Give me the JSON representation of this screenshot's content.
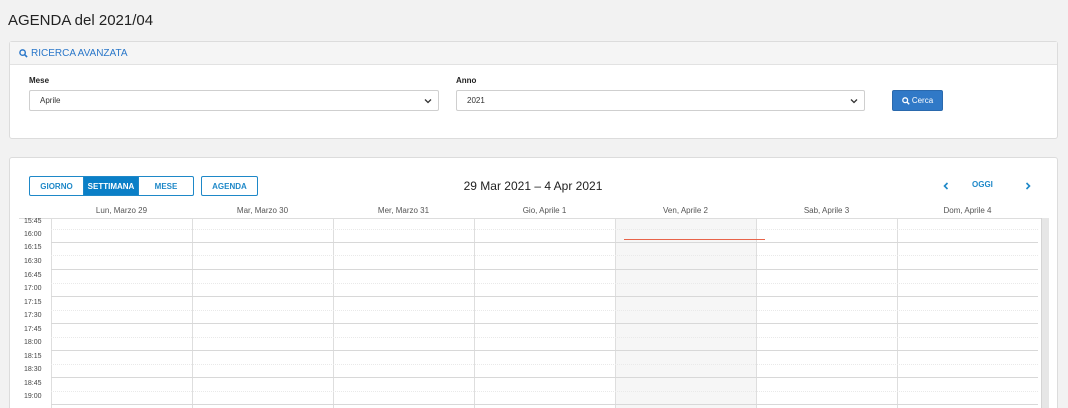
{
  "page": {
    "title": "AGENDA del 2021/04"
  },
  "search": {
    "header": "RICERCA AVANZATA",
    "month_label": "Mese",
    "month_value": "Aprile",
    "year_label": "Anno",
    "year_value": "2021",
    "search_button": "Cerca"
  },
  "calendar": {
    "views": [
      "GIORNO",
      "SETTIMANA",
      "MESE"
    ],
    "active_view": "SETTIMANA",
    "agenda_button": "AGENDA",
    "range_title": "29 Mar 2021 – 4 Apr 2021",
    "today_button": "OGGI",
    "days": [
      "Lun, Marzo 29",
      "Mar, Marzo 30",
      "Mer, Marzo 31",
      "Gio, Aprile 1",
      "Ven, Aprile 2",
      "Sab, Aprile 3",
      "Dom, Aprile 4"
    ],
    "today_index": 4,
    "times": [
      "15:45",
      "16:00",
      "16:15",
      "16:30",
      "16:45",
      "17:00",
      "17:15",
      "17:30",
      "17:45",
      "18:00",
      "18:15",
      "18:30",
      "18:45",
      "19:00"
    ]
  },
  "colors": {
    "accent": "#1e88c8",
    "search_button": "#3079c7",
    "now_line": "#e8644a"
  },
  "icons": {
    "search": "search-icon",
    "prev": "chevron-left-icon",
    "next": "chevron-right-icon",
    "dropdown": "chevron-down-icon"
  }
}
